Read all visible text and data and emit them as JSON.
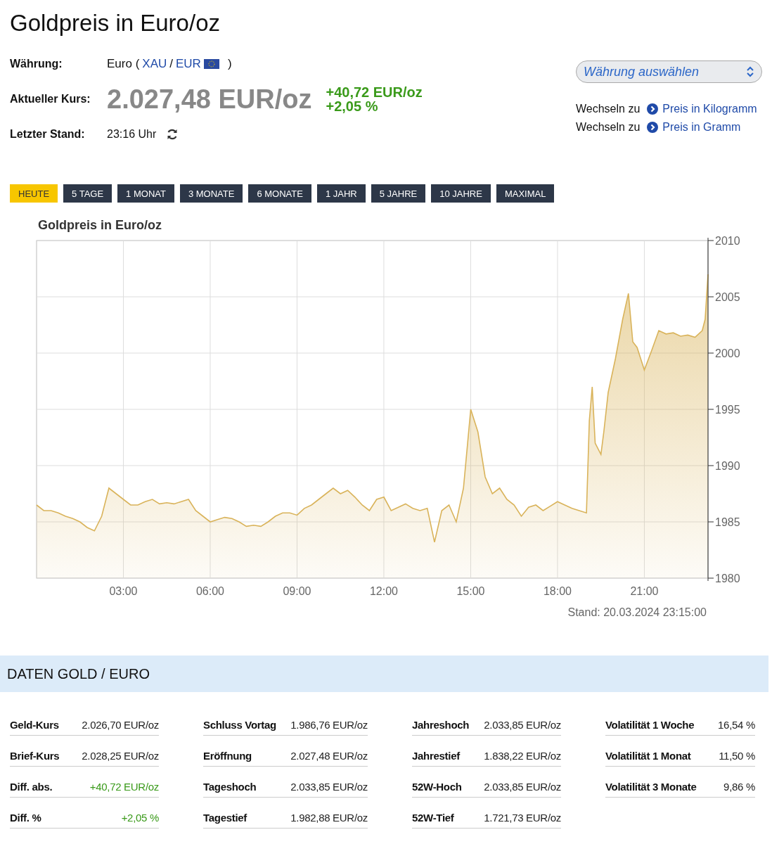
{
  "title": "Goldpreis in Euro/oz",
  "info": {
    "currency_label": "Währung:",
    "currency_prefix": "Euro (",
    "currency_base": "XAU",
    "currency_sep": "/",
    "currency_quote": "EUR",
    "currency_suffix": ")",
    "price_label": "Aktueller Kurs:",
    "price": "2.027,48 EUR/oz",
    "change_abs": "+40,72 EUR/oz",
    "change_pct": "+2,05 %",
    "updated_label": "Letzter Stand:",
    "updated": "23:16 Uhr"
  },
  "currency_select": {
    "placeholder": "Währung auswählen"
  },
  "switch_links": [
    {
      "prefix": "Wechseln zu",
      "label": "Preis in Kilogramm"
    },
    {
      "prefix": "Wechseln zu",
      "label": "Preis in Gramm"
    }
  ],
  "range_tabs": [
    {
      "label": "HEUTE",
      "selected": true
    },
    {
      "label": "5 TAGE",
      "selected": false
    },
    {
      "label": "1 MONAT",
      "selected": false
    },
    {
      "label": "3 MONATE",
      "selected": false
    },
    {
      "label": "6 MONATE",
      "selected": false
    },
    {
      "label": "1 JAHR",
      "selected": false
    },
    {
      "label": "5 JAHRE",
      "selected": false
    },
    {
      "label": "10 JAHRE",
      "selected": false
    },
    {
      "label": "MAXIMAL",
      "selected": false
    }
  ],
  "chart": {
    "stand": "Stand: 20.03.2024 23:15:00",
    "chart_data": {
      "type": "area",
      "title": "Goldpreis in Euro/oz",
      "x": [
        0,
        0.25,
        0.5,
        0.75,
        1,
        1.25,
        1.5,
        1.75,
        2,
        2.25,
        2.5,
        2.75,
        3,
        3.25,
        3.5,
        3.75,
        4,
        4.25,
        4.5,
        4.75,
        5,
        5.25,
        5.5,
        5.75,
        6,
        6.25,
        6.5,
        6.75,
        7,
        7.25,
        7.5,
        7.75,
        8,
        8.25,
        8.5,
        8.75,
        9,
        9.25,
        9.5,
        9.75,
        10,
        10.25,
        10.5,
        10.75,
        11,
        11.25,
        11.5,
        11.75,
        12,
        12.25,
        12.5,
        12.75,
        13,
        13.25,
        13.5,
        13.75,
        14,
        14.25,
        14.5,
        14.75,
        15,
        15.25,
        15.5,
        15.75,
        16,
        16.25,
        16.5,
        16.75,
        17,
        17.25,
        17.5,
        17.75,
        18,
        18.25,
        18.5,
        18.75,
        19,
        19.1,
        19.2,
        19.3,
        19.5,
        19.6,
        19.75,
        20,
        20.25,
        20.45,
        20.6,
        20.75,
        21,
        21.25,
        21.5,
        21.75,
        22,
        22.25,
        22.5,
        22.75,
        23,
        23.1,
        23.2
      ],
      "grid": true,
      "series": [
        {
          "color": "#d9b35a",
          "values": [
            1986.5,
            1986,
            1986,
            1985.8,
            1985.5,
            1985.3,
            1985,
            1984.5,
            1984.2,
            1985.5,
            1988,
            1987.5,
            1987,
            1986.5,
            1986.5,
            1986.8,
            1987,
            1986.6,
            1986.7,
            1986.6,
            1986.8,
            1987,
            1986,
            1985.5,
            1985,
            1985.2,
            1985.4,
            1985.3,
            1985,
            1984.6,
            1984.7,
            1984.6,
            1985,
            1985.5,
            1985.8,
            1985.8,
            1985.6,
            1986.2,
            1986.5,
            1987,
            1987.5,
            1988,
            1987.5,
            1987.8,
            1987.2,
            1986.5,
            1986,
            1987,
            1987.2,
            1986,
            1986.3,
            1986.6,
            1986.2,
            1986,
            1986.2,
            1983.2,
            1986,
            1986.5,
            1985,
            1988,
            1995,
            1993,
            1989,
            1987.5,
            1988,
            1987,
            1986.5,
            1985.5,
            1986.3,
            1986.5,
            1986,
            1986.4,
            1986.8,
            1986.5,
            1986.2,
            1986,
            1985.8,
            1994,
            1997,
            1992,
            1991,
            1993,
            1996.5,
            1999.5,
            2003,
            2005.3,
            2001,
            2000.5,
            1998.5,
            2000.2,
            2002,
            2001.7,
            2001.8,
            2001.5,
            2001.6,
            2001.4,
            2002,
            2003,
            2007
          ]
        }
      ],
      "xlim": [
        0,
        23.2
      ],
      "ylim": [
        1980,
        2010
      ],
      "xticks": [
        {
          "value": 3,
          "label": "03:00"
        },
        {
          "value": 6,
          "label": "06:00"
        },
        {
          "value": 9,
          "label": "09:00"
        },
        {
          "value": 12,
          "label": "12:00"
        },
        {
          "value": 15,
          "label": "15:00"
        },
        {
          "value": 18,
          "label": "18:00"
        },
        {
          "value": 21,
          "label": "21:00"
        }
      ],
      "yticks": [
        1980,
        1985,
        1990,
        1995,
        2000,
        2005,
        2010
      ]
    }
  },
  "data_section": {
    "title": "DATEN GOLD / EURO",
    "columns": [
      {
        "rows": [
          {
            "label": "Geld-Kurs",
            "value": "2.026,70 EUR/oz",
            "color": "#222222"
          },
          {
            "label": "Brief-Kurs",
            "value": "2.028,25 EUR/oz",
            "color": "#222222"
          },
          {
            "label": "Diff. abs.",
            "value": "+40,72 EUR/oz",
            "color": "#3a9a1a"
          },
          {
            "label": "Diff. %",
            "value": "+2,05 %",
            "color": "#3a9a1a"
          }
        ]
      },
      {
        "rows": [
          {
            "label": "Schluss Vortag",
            "value": "1.986,76 EUR/oz",
            "color": "#222222"
          },
          {
            "label": "Eröffnung",
            "value": "2.027,48 EUR/oz",
            "color": "#222222"
          },
          {
            "label": "Tageshoch",
            "value": "2.033,85 EUR/oz",
            "color": "#222222"
          },
          {
            "label": "Tagestief",
            "value": "1.982,88 EUR/oz",
            "color": "#222222"
          }
        ]
      },
      {
        "rows": [
          {
            "label": "Jahreshoch",
            "value": "2.033,85 EUR/oz",
            "color": "#222222"
          },
          {
            "label": "Jahrestief",
            "value": "1.838,22 EUR/oz",
            "color": "#222222"
          },
          {
            "label": "52W-Hoch",
            "value": "2.033,85 EUR/oz",
            "color": "#222222"
          },
          {
            "label": "52W-Tief",
            "value": "1.721,73 EUR/oz",
            "color": "#222222"
          }
        ]
      },
      {
        "rows": [
          {
            "label": "Volatilität 1 Woche",
            "value": "16,54 %",
            "color": "#222222"
          },
          {
            "label": "Volatilität 1 Monat",
            "value": "11,50 %",
            "color": "#222222"
          },
          {
            "label": "Volatilität 3 Monate",
            "value": "9,86 %",
            "color": "#222222"
          }
        ]
      }
    ]
  }
}
